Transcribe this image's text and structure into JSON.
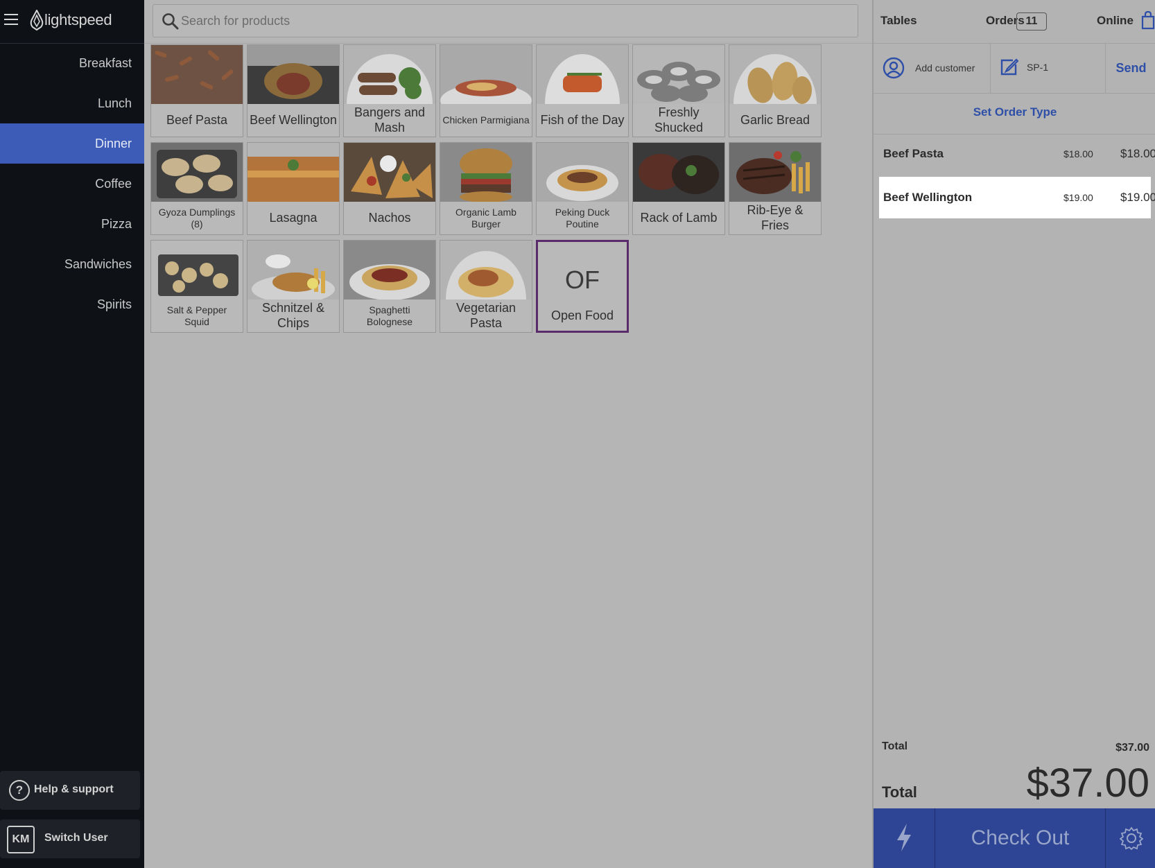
{
  "brand": {
    "name": "lightspeed"
  },
  "sidebar": {
    "categories": [
      {
        "label": "Breakfast"
      },
      {
        "label": "Lunch"
      },
      {
        "label": "Dinner"
      },
      {
        "label": "Coffee"
      },
      {
        "label": "Pizza"
      },
      {
        "label": "Sandwiches"
      },
      {
        "label": "Spirits"
      }
    ],
    "active_category": "Dinner",
    "help_label": "Help & support",
    "user_initials": "KM",
    "switch_user_label": "Switch User"
  },
  "search": {
    "placeholder": "Search for products"
  },
  "products": [
    {
      "name": "Beef Pasta"
    },
    {
      "name": "Beef Wellington"
    },
    {
      "name": "Bangers and Mash"
    },
    {
      "name": "Chicken Parmigiana"
    },
    {
      "name": "Fish of the Day"
    },
    {
      "name": "Freshly Shucked"
    },
    {
      "name": "Garlic Bread"
    },
    {
      "name": "Gyoza Dumplings (8)"
    },
    {
      "name": "Lasagna"
    },
    {
      "name": "Nachos"
    },
    {
      "name": "Organic Lamb Burger"
    },
    {
      "name": "Peking Duck Poutine"
    },
    {
      "name": "Rack of Lamb"
    },
    {
      "name": "Rib-Eye & Fries"
    },
    {
      "name": "Salt & Pepper Squid"
    },
    {
      "name": "Schnitzel & Chips"
    },
    {
      "name": "Spaghetti Bolognese"
    },
    {
      "name": "Vegetarian Pasta"
    }
  ],
  "open_food": {
    "initials": "OF",
    "label": "Open Food"
  },
  "order_panel": {
    "tabs": {
      "tables": "Tables",
      "orders": "Orders",
      "orders_count": "11",
      "online": "Online"
    },
    "add_customer": "Add customer",
    "order_ref": "SP-1",
    "send": "Send",
    "set_order_type": "Set Order Type",
    "lines": [
      {
        "name": "Beef Pasta",
        "unit_price": "$18.00",
        "total": "$18.00"
      },
      {
        "name": "Beef Wellington",
        "unit_price": "$19.00",
        "total": "$19.00"
      }
    ],
    "subtotal_label": "Total",
    "subtotal_value": "$37.00",
    "total_label": "Total",
    "total_value": "$37.00",
    "checkout_label": "Check Out"
  },
  "colors": {
    "sidebar_bg": "#0e1116",
    "active_category": "#3c5cb8",
    "accent_blue": "#2e4fa8",
    "checkout_bar": "#2d4594",
    "open_food_border": "#5b2a6a"
  },
  "icons": [
    "hamburger-icon",
    "lightspeed-logo-icon",
    "search-icon",
    "help-icon",
    "bag-icon",
    "user-icon",
    "edit-icon",
    "flash-icon",
    "gear-icon"
  ]
}
